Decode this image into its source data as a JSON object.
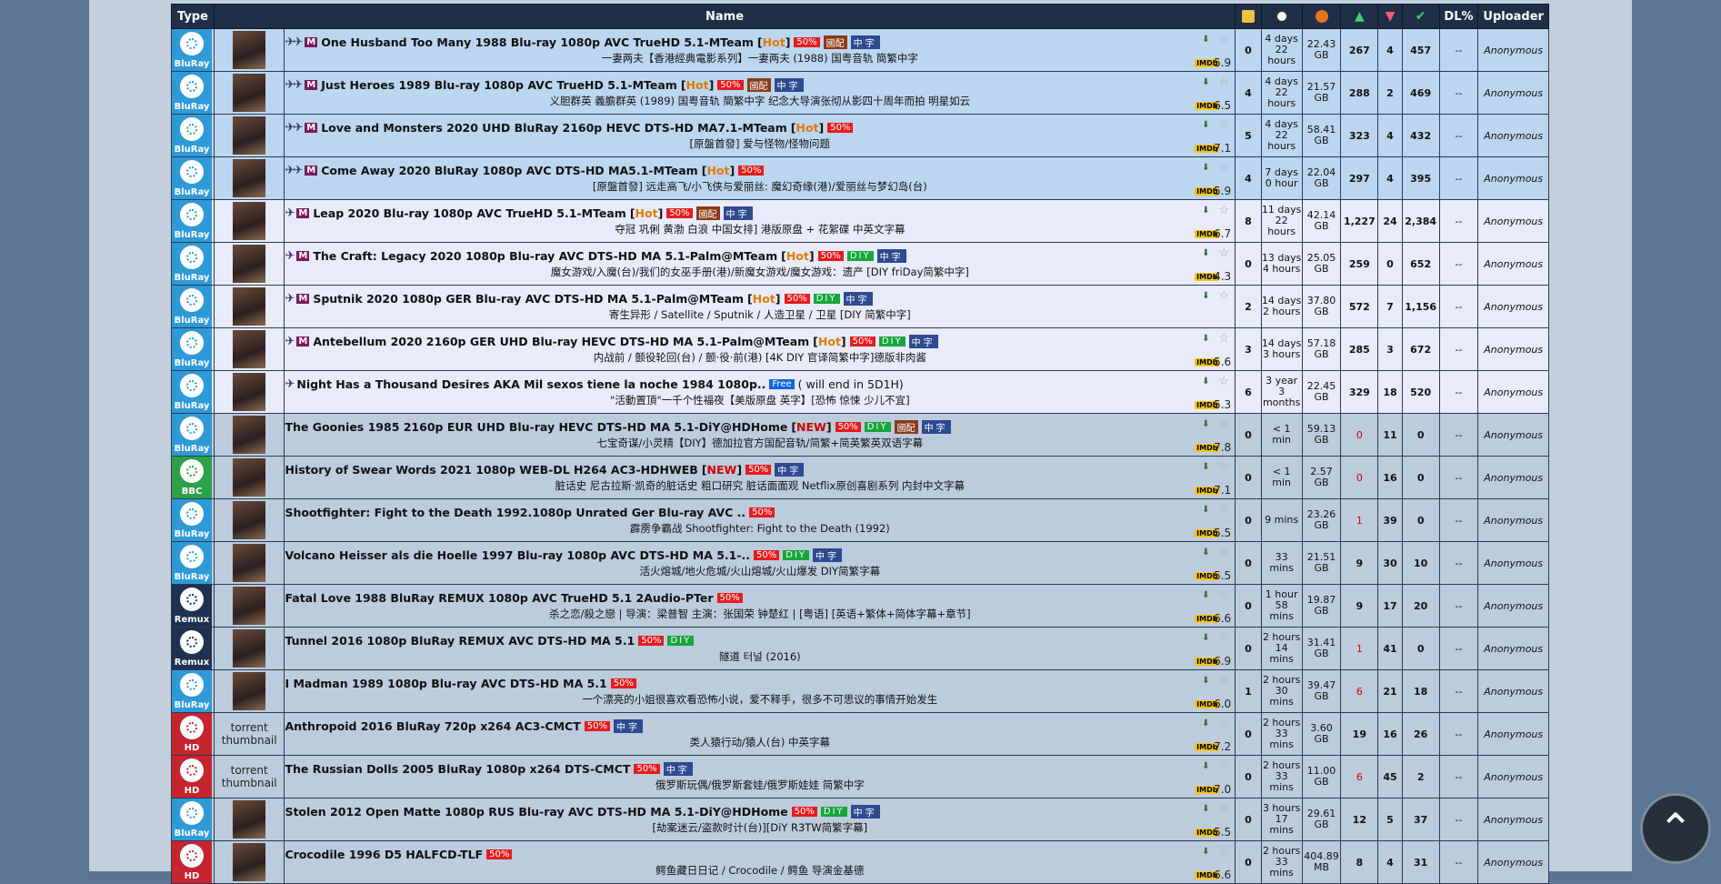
{
  "headers": {
    "type": "Type",
    "name": "Name",
    "dl": "DL%",
    "uploader": "Uploader"
  },
  "rows": [
    {
      "style": "sticky",
      "type": "BluRay",
      "pins": 2,
      "mtag": "M",
      "title": "One Husband Too Many 1988 Blu-ray 1080p AVC TrueHD 5.1-MTeam",
      "flag": "Hot",
      "tags": [
        "50%",
        "國配",
        "中字"
      ],
      "sub": "一妻两夫【香港經典電影系列】一妻两夫 (1988) 国粤音轨 簡繁中字",
      "score": "5.9",
      "comments": "0",
      "time": [
        "4 days",
        "22 hours"
      ],
      "size": [
        "22.43",
        "GB"
      ],
      "seeders": "267",
      "leechers": "4",
      "completed": "457",
      "dl": "--",
      "uploader": "Anonymous"
    },
    {
      "style": "sticky",
      "type": "BluRay",
      "pins": 2,
      "mtag": "M",
      "title": "Just Heroes 1989 Blu-ray 1080p AVC TrueHD 5.1-MTeam",
      "flag": "Hot",
      "tags": [
        "50%",
        "國配",
        "中字"
      ],
      "sub": "义胆群英 義膽群英 (1989) 国粤音轨 簡繁中字 纪念大导演张彻从影四十周年而拍 明星如云",
      "score": "6.5",
      "comments": "4",
      "time": [
        "4 days",
        "22 hours"
      ],
      "size": [
        "21.57",
        "GB"
      ],
      "seeders": "288",
      "leechers": "2",
      "completed": "469",
      "dl": "--",
      "uploader": "Anonymous"
    },
    {
      "style": "sticky",
      "type": "BluRay",
      "pins": 2,
      "mtag": "M",
      "title": "Love and Monsters 2020 UHD BluRay 2160p HEVC DTS-HD MA7.1-MTeam",
      "flag": "Hot",
      "tags": [
        "50%"
      ],
      "sub": "[原盤首發] 爱与怪物/怪物问题",
      "score": "7.1",
      "comments": "5",
      "time": [
        "4 days",
        "22 hours"
      ],
      "size": [
        "58.41",
        "GB"
      ],
      "seeders": "323",
      "leechers": "4",
      "completed": "432",
      "dl": "--",
      "uploader": "Anonymous"
    },
    {
      "style": "sticky",
      "type": "BluRay",
      "pins": 2,
      "mtag": "M",
      "title": "Come Away 2020 BluRay 1080p AVC DTS-HD MA5.1-MTeam",
      "flag": "Hot",
      "tags": [
        "50%"
      ],
      "sub": "[原盤首發] 远走高飞/小飞侠与爱丽丝: 魔幻奇缘(港)/爱丽丝与梦幻岛(台)",
      "score": "5.9",
      "comments": "4",
      "time": [
        "7 days",
        "0 hour"
      ],
      "size": [
        "22.04",
        "GB"
      ],
      "seeders": "297",
      "leechers": "4",
      "completed": "395",
      "dl": "--",
      "uploader": "Anonymous"
    },
    {
      "style": "hot",
      "type": "BluRay",
      "pins": 1,
      "mtag": "M",
      "title": "Leap 2020 Blu-ray 1080p AVC TrueHD 5.1-MTeam",
      "flag": "Hot",
      "tags": [
        "50%",
        "國配",
        "中字"
      ],
      "sub": "夺冠 巩俐 黄渤 白浪 中国女排] 港版原盘 + 花絮碟 中英文字幕",
      "score": "6.7",
      "comments": "8",
      "time": [
        "11 days",
        "22 hours"
      ],
      "size": [
        "42.14",
        "GB"
      ],
      "seeders": "1,227",
      "leechers": "24",
      "completed": "2,384",
      "dl": "--",
      "uploader": "Anonymous"
    },
    {
      "style": "hot",
      "type": "BluRay",
      "pins": 1,
      "mtag": "M",
      "title": "The Craft:  Legacy 2020 1080p Blu-ray AVC DTS-HD MA 5.1-Palm@MTeam",
      "flag": "Hot",
      "tags": [
        "50%",
        "DIY",
        "中字"
      ],
      "sub": "魔女游戏/入魔(台)/我们的女巫手册(港)/新魔女游戏/魔女游戏：遗产 [DIY friDay简繁中字]",
      "score": "4.3",
      "comments": "0",
      "time": [
        "13 days",
        "4 hours"
      ],
      "size": [
        "25.05",
        "GB"
      ],
      "seeders": "259",
      "leechers": "0",
      "completed": "652",
      "dl": "--",
      "uploader": "Anonymous"
    },
    {
      "style": "hot",
      "type": "BluRay",
      "pins": 1,
      "mtag": "M",
      "title": "Sputnik 2020 1080p GER Blu-ray AVC DTS-HD MA 5.1-Palm@MTeam",
      "flag": "Hot",
      "tags": [
        "50%",
        "DIY",
        "中字"
      ],
      "sub": "寄生异形 / Satellite / Sputnik / 人造卫星 / 卫星 [DIY 简繁中字]",
      "score": "",
      "comments": "2",
      "time": [
        "14 days",
        "2 hours"
      ],
      "size": [
        "37.80",
        "GB"
      ],
      "seeders": "572",
      "leechers": "7",
      "completed": "1,156",
      "dl": "--",
      "uploader": "Anonymous"
    },
    {
      "style": "hot",
      "type": "BluRay",
      "pins": 1,
      "mtag": "M",
      "title": "Antebellum 2020 2160p GER UHD Blu-ray HEVC DTS-HD MA 5.1-Palm@MTeam",
      "flag": "Hot",
      "tags": [
        "50%",
        "DIY",
        "中字"
      ],
      "sub": "内战前 / 颤役轮回(台) / 颤·役·前(港) [4K DIY 官译简繁中字]德版非肉酱",
      "score": "5.6",
      "comments": "3",
      "time": [
        "14 days",
        "3 hours"
      ],
      "size": [
        "57.18",
        "GB"
      ],
      "seeders": "285",
      "leechers": "3",
      "completed": "672",
      "dl": "--",
      "uploader": "Anonymous"
    },
    {
      "style": "hot",
      "type": "BluRay",
      "pins": 1,
      "mtag": "",
      "title": "Night Has a Thousand Desires AKA Mil sexos tiene la noche 1984 1080p..",
      "flag": "",
      "tags": [
        "Free"
      ],
      "freenote": "( will end in 5D1H)",
      "sub": "\"活動置頂\"一千个性福夜【美版原盘 英字】[恐怖 惊悚 少儿不宜]",
      "score": "5.3",
      "comments": "6",
      "time": [
        "3 year",
        "3 months"
      ],
      "size": [
        "22.45",
        "GB"
      ],
      "seeders": "329",
      "leechers": "18",
      "completed": "520",
      "dl": "--",
      "uploader": "Anonymous"
    },
    {
      "style": "normal",
      "type": "BluRay",
      "pins": 0,
      "mtag": "",
      "title": "The Goonies 1985 2160p EUR UHD Blu-ray HEVC DTS-HD MA 5.1-DiY@HDHome",
      "flag": "NEW",
      "tags": [
        "50%",
        "DIY",
        "國配",
        "中字"
      ],
      "sub": "七宝奇谋/小灵精【DIY】德加拉官方国配音轨/简繁+简英繁英双语字幕",
      "score": "7.8",
      "comments": "0",
      "time": [
        "< 1 min"
      ],
      "size": [
        "59.13",
        "GB"
      ],
      "seeders": "0",
      "seedersRed": true,
      "leechers": "11",
      "completed": "0",
      "dl": "--",
      "uploader": "Anonymous"
    },
    {
      "style": "normal",
      "type": "BBC",
      "pins": 0,
      "mtag": "",
      "title": "History of Swear Words 2021 1080p WEB-DL H264 AC3-HDHWEB",
      "flag": "NEW",
      "tags": [
        "50%",
        "中字"
      ],
      "sub": "脏话史 尼古拉斯·凯奇的脏话史 粗口研究 脏话面面观 Netflix原创喜剧系列 内封中文字幕",
      "score": "7.1",
      "comments": "0",
      "time": [
        "< 1 min"
      ],
      "size": [
        "2.57",
        "GB"
      ],
      "seeders": "0",
      "seedersRed": true,
      "leechers": "16",
      "completed": "0",
      "dl": "--",
      "uploader": "Anonymous"
    },
    {
      "style": "normal",
      "type": "BluRay",
      "pins": 0,
      "mtag": "",
      "title": "Shootfighter: Fight to the Death 1992.1080p Unrated Ger Blu-ray AVC ..",
      "flag": "",
      "tags": [
        "50%"
      ],
      "sub": "霹雳争霸战 Shootfighter: Fight to the Death (1992)",
      "score": "5.5",
      "comments": "0",
      "time": [
        "9 mins"
      ],
      "size": [
        "23.26",
        "GB"
      ],
      "seeders": "1",
      "seedersRed": true,
      "leechers": "39",
      "completed": "0",
      "dl": "--",
      "uploader": "Anonymous"
    },
    {
      "style": "normal",
      "type": "BluRay",
      "pins": 0,
      "mtag": "",
      "title": "Volcano Heisser als die Hoelle 1997 Blu-ray 1080p AVC DTS-HD MA 5.1-..",
      "flag": "",
      "tags": [
        "50%",
        "DIY",
        "中字"
      ],
      "sub": "活火熔城/地火危城/火山熔城/火山爆发 DIY简繁字幕",
      "score": "5.5",
      "comments": "0",
      "time": [
        "33 mins"
      ],
      "size": [
        "21.51",
        "GB"
      ],
      "seeders": "9",
      "leechers": "30",
      "completed": "10",
      "dl": "--",
      "uploader": "Anonymous"
    },
    {
      "style": "normal",
      "type": "Remux",
      "pins": 0,
      "mtag": "",
      "title": "Fatal Love 1988 BluRay REMUX 1080p AVC TrueHD 5.1 2Audio-PTer",
      "flag": "",
      "tags": [
        "50%"
      ],
      "sub": "杀之恋/殺之戀 | 导演：梁普智 主演：张国荣 钟楚红 | [粤语] [英语+繁体+简体字幕+章节]",
      "score": "6.6",
      "comments": "0",
      "time": [
        "1 hour",
        "58 mins"
      ],
      "size": [
        "19.87",
        "GB"
      ],
      "seeders": "9",
      "leechers": "17",
      "completed": "20",
      "dl": "--",
      "uploader": "Anonymous"
    },
    {
      "style": "normal",
      "type": "Remux",
      "pins": 0,
      "mtag": "",
      "title": "Tunnel 2016 1080p BluRay REMUX AVC DTS-HD MA 5.1",
      "flag": "",
      "tags": [
        "50%",
        "DIY"
      ],
      "sub": "隧道 터널 (2016)",
      "score": "6.9",
      "comments": "0",
      "time": [
        "2 hours",
        "14 mins"
      ],
      "size": [
        "31.41",
        "GB"
      ],
      "seeders": "1",
      "seedersRed": true,
      "leechers": "41",
      "completed": "0",
      "dl": "--",
      "uploader": "Anonymous"
    },
    {
      "style": "normal",
      "type": "BluRay",
      "pins": 0,
      "mtag": "",
      "title": "I Madman 1989 1080p Blu-ray AVC DTS-HD MA 5.1",
      "flag": "",
      "tags": [
        "50%"
      ],
      "sub": "一个漂亮的小姐很喜欢看恐怖小说，爱不释手，很多不可思议的事情开始发生",
      "score": "6.0",
      "comments": "1",
      "time": [
        "2 hours",
        "30 mins"
      ],
      "size": [
        "39.47",
        "GB"
      ],
      "seeders": "6",
      "seedersRed": true,
      "leechers": "21",
      "completed": "18",
      "dl": "--",
      "uploader": "Anonymous"
    },
    {
      "style": "normal",
      "type": "HD",
      "pins": 0,
      "mtag": "",
      "thumbText": "torrent thumbnail",
      "title": "Anthropoid 2016 BluRay 720p x264 AC3-CMCT",
      "flag": "",
      "tags": [
        "50%",
        "中字"
      ],
      "sub": "类人猿行动/猿人(台) 中英字幕",
      "score": "7.2",
      "comments": "0",
      "time": [
        "2 hours",
        "33 mins"
      ],
      "size": [
        "3.60",
        "GB"
      ],
      "seeders": "19",
      "leechers": "16",
      "completed": "26",
      "dl": "--",
      "uploader": "Anonymous"
    },
    {
      "style": "normal",
      "type": "HD",
      "pins": 0,
      "mtag": "",
      "thumbText": "torrent thumbnail",
      "title": "The Russian Dolls 2005 BluRay 1080p x264 DTS-CMCT",
      "flag": "",
      "tags": [
        "50%",
        "中字"
      ],
      "sub": "俄罗斯玩偶/俄罗斯套娃/俄罗斯娃娃 简繁中字",
      "score": "7.0",
      "comments": "0",
      "time": [
        "2 hours",
        "33 mins"
      ],
      "size": [
        "11.00",
        "GB"
      ],
      "seeders": "6",
      "seedersRed": true,
      "leechers": "45",
      "completed": "2",
      "dl": "--",
      "uploader": "Anonymous"
    },
    {
      "style": "normal",
      "type": "BluRay",
      "pins": 0,
      "mtag": "",
      "title": "Stolen 2012 Open Matte 1080p RUS Blu-ray AVC DTS-HD MA 5.1-DiY@HDHome",
      "flag": "",
      "tags": [
        "50%",
        "DIY",
        "中字"
      ],
      "sub": "[劫案迷云/盗款时计(台)][DiY R3TW简繁字幕]",
      "score": "5.5",
      "comments": "0",
      "time": [
        "3 hours",
        "17 mins"
      ],
      "size": [
        "29.61",
        "GB"
      ],
      "seeders": "12",
      "leechers": "5",
      "completed": "37",
      "dl": "--",
      "uploader": "Anonymous"
    },
    {
      "style": "normal",
      "type": "HD",
      "pins": 0,
      "mtag": "",
      "title": "Crocodile 1996 D5 HALFCD-TLF",
      "flag": "",
      "tags": [
        "50%"
      ],
      "sub": "鳄鱼藏日日记 / Crocodile / 鳄鱼 导演金基德",
      "score": "6.6",
      "comments": "0",
      "time": [
        "2 hours",
        "33 mins"
      ],
      "size": [
        "404.89",
        "MB"
      ],
      "seeders": "8",
      "leechers": "4",
      "completed": "31",
      "dl": "--",
      "uploader": "Anonymous"
    }
  ],
  "icons": {
    "imdb": "IMDb",
    "backToTop": "chevron-up-icon"
  }
}
